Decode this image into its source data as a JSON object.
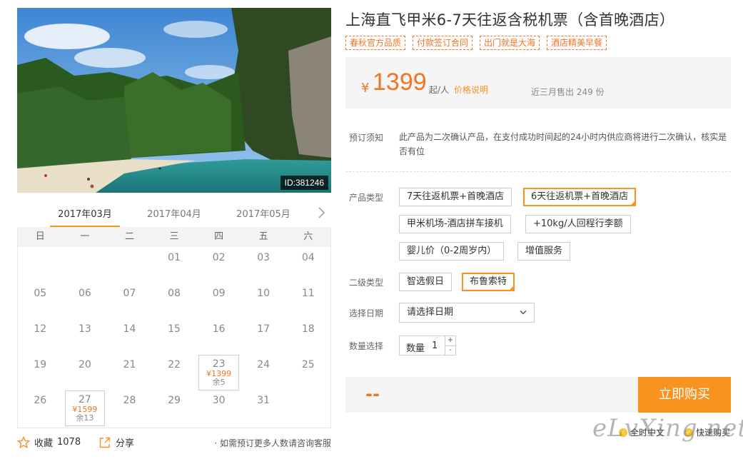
{
  "photo": {
    "id_badge": "ID:381246"
  },
  "calendar": {
    "months": [
      "2017年03月",
      "2017年04月",
      "2017年05月"
    ],
    "weekdays": [
      "日",
      "一",
      "二",
      "三",
      "四",
      "五",
      "六"
    ],
    "rows": [
      [
        "",
        "",
        "",
        "01",
        "02",
        "03",
        "04"
      ],
      [
        "05",
        "06",
        "07",
        "08",
        "09",
        "10",
        "11"
      ],
      [
        "12",
        "13",
        "14",
        "15",
        "16",
        "17",
        "18"
      ],
      [
        "19",
        "20",
        "21",
        "22",
        "23",
        "24",
        "25"
      ],
      [
        "26",
        "27",
        "28",
        "29",
        "30",
        "31",
        ""
      ]
    ],
    "available": {
      "23": {
        "price": "¥1399",
        "remaining": "余5"
      },
      "27": {
        "price": "¥1599",
        "remaining": "余13"
      }
    }
  },
  "footer": {
    "favorite_label": "收藏",
    "favorite_count": "1078",
    "share_label": "分享",
    "consult": "· 如需预订更多人数请咨询客服"
  },
  "product": {
    "title": "上海直飞甲米6-7天往返含税机票（含首晚酒店）",
    "tags": [
      "春秋官方品质",
      "付款签订合同",
      "出门就是大海",
      "酒店精美早餐"
    ],
    "price": {
      "currency": "¥",
      "amount": "1399",
      "unit": "起/人",
      "note": "价格说明",
      "sold": "近三月售出 249 份"
    },
    "notice_label": "预订须知",
    "notice_text": "此产品为二次确认产品，在支付成功时间起的24小时内供应商将进行二次确认，核实是否有位",
    "type_label": "产品类型",
    "types": [
      "7天往返机票+首晚酒店",
      "6天往返机票+首晚酒店",
      "甲米机场-酒店拼车接机",
      "+10kg/人回程行李额",
      "婴儿价（0-2周岁内）",
      "增值服务"
    ],
    "selected_type": "6天往返机票+首晚酒店",
    "subtype_label": "二级类型",
    "subtypes": [
      "智选假日",
      "布鲁索特"
    ],
    "selected_subtype": "布鲁索特",
    "date_label": "选择日期",
    "date_placeholder": "请选择日期",
    "qty_label": "数量选择",
    "qty_inner_label": "数量",
    "qty_value": "1",
    "qty_plus": "+",
    "qty_minus": "-"
  },
  "buy": {
    "total": "--",
    "button": "立即购买"
  },
  "guarantees": [
    "全时中文",
    "快速购买"
  ],
  "watermark": "eLvXing.net",
  "colors": {
    "accent": "#f7931e",
    "price": "#f27420"
  }
}
